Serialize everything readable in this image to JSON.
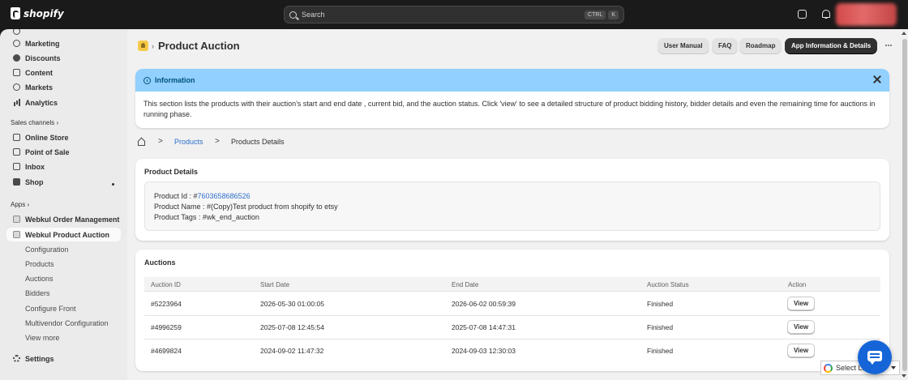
{
  "topbar": {
    "logo_text": "shopify",
    "search_placeholder": "Search",
    "kbd_ctrl": "CTRL",
    "kbd_k": "K"
  },
  "sidebar": {
    "items_top": [
      {
        "label": "Marketing",
        "icon": "target-icon"
      },
      {
        "label": "Discounts",
        "icon": "discount-icon"
      },
      {
        "label": "Content",
        "icon": "content-icon"
      },
      {
        "label": "Markets",
        "icon": "globe-icon"
      },
      {
        "label": "Analytics",
        "icon": "bar-chart-icon"
      }
    ],
    "sales_channels_label": "Sales channels",
    "sales_channels": [
      {
        "label": "Online Store",
        "icon": "store-icon"
      },
      {
        "label": "Point of Sale",
        "icon": "pos-icon"
      },
      {
        "label": "Inbox",
        "icon": "inbox-icon"
      },
      {
        "label": "Shop",
        "icon": "shop-icon"
      }
    ],
    "apps_label": "Apps",
    "apps": [
      {
        "label": "Webkul Order Management"
      },
      {
        "label": "Webkul Product Auction"
      }
    ],
    "sub_items": [
      "Configuration",
      "Products",
      "Auctions",
      "Bidders",
      "Configure Front",
      "Multivendor Configuration",
      "View more"
    ],
    "settings_label": "Settings",
    "section_chevron": "›"
  },
  "header": {
    "separator": "›",
    "title": "Product Auction",
    "buttons": {
      "user_manual": "User Manual",
      "faq": "FAQ",
      "roadmap": "Roadmap",
      "app_info": "App Information & Details"
    }
  },
  "info_banner": {
    "title": "Information",
    "body": "This section lists the products with their auction's start and end date , current bid, and the auction status. Click 'view' to see a detailed structure of product bidding history, bidder details and even the remaining time for auctions in running phase."
  },
  "breadcrumb": {
    "separator": ">",
    "link": "Products",
    "current": "Products Details"
  },
  "product_details": {
    "title": "Product Details",
    "id_label": "Product Id : #",
    "id_value": "7603658686526",
    "name_line": "Product Name : #(Copy)Test product from shopify to etsy",
    "tags_line": "Product Tags : #wk_end_auction"
  },
  "auctions": {
    "title": "Auctions",
    "columns": [
      "Auction ID",
      "Start Date",
      "End Date",
      "Auction Status",
      "Action"
    ],
    "rows": [
      {
        "id": "#5223964",
        "start": "2026-05-30 01:00:05",
        "end": "2026-06-02 00:59:39",
        "status": "Finished",
        "action": "View"
      },
      {
        "id": "#4996259",
        "start": "2025-07-08 12:45:54",
        "end": "2025-07-08 14:47:31",
        "status": "Finished",
        "action": "View"
      },
      {
        "id": "#4699824",
        "start": "2024-09-02 11:47:32",
        "end": "2024-09-03 12:30:03",
        "status": "Finished",
        "action": "View"
      }
    ]
  },
  "translate": {
    "label": "Select La"
  },
  "colors": {
    "accent_blue": "#2c6ecb",
    "info_bg": "#91d0ff",
    "chat_blue": "#1565d8"
  }
}
